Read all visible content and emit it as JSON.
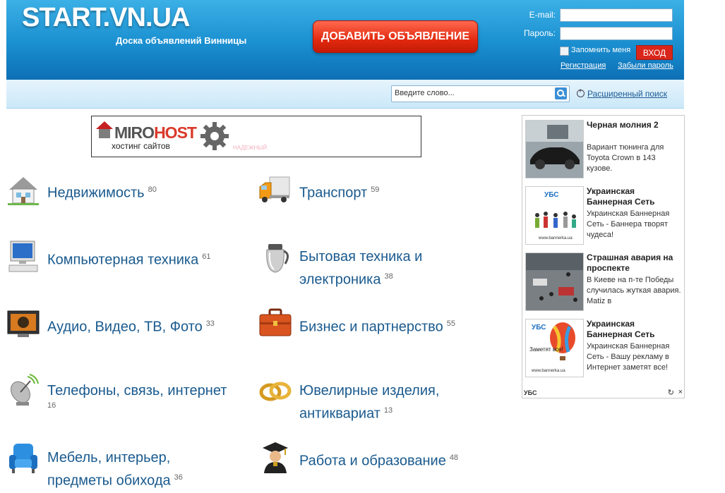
{
  "header": {
    "logo": "START.VN.UA",
    "tagline": "Доска объявлений Винницы",
    "add_button": "ДОБАВИТЬ ОБЪЯВЛЕНИЕ",
    "email_label": "E-mail:",
    "password_label": "Пароль:",
    "remember_label": "Запомнить меня",
    "login_button": "ВХОД",
    "register_link": "Регистрация",
    "forgot_link": "Забыли пароль"
  },
  "search": {
    "placeholder": "Введите слово...",
    "advanced_link": "Расширенный поиск"
  },
  "banner": {
    "brand_a": "MIRO",
    "brand_b": "HOST",
    "subtitle": "хостинг сайтов",
    "tail": "НАДЕЖНЫЙ"
  },
  "categories": [
    {
      "label": "Недвижимость",
      "count": "80",
      "icon": "house-icon"
    },
    {
      "label": "Транспорт",
      "count": "59",
      "icon": "truck-icon"
    },
    {
      "label": "Компьютерная техника",
      "count": "61",
      "icon": "computer-icon"
    },
    {
      "label": "Бытовая техника и",
      "label2": "электроника",
      "count": "38",
      "icon": "kettle-icon"
    },
    {
      "label": "Аудио, Видео, ТВ, Фото",
      "count": "33",
      "icon": "tv-icon"
    },
    {
      "label": "Бизнес и партнерство",
      "count": "55",
      "icon": "briefcase-icon"
    },
    {
      "label": "Телефоны, связь, интернет",
      "count": "16",
      "icon": "satellite-icon"
    },
    {
      "label": "Ювелирные изделия,",
      "label2": "антиквариат",
      "count": "13",
      "icon": "rings-icon"
    },
    {
      "label": "Мебель, интерьер,",
      "label2": "предметы обихода",
      "count": "36",
      "icon": "armchair-icon"
    },
    {
      "label": "Работа и образование",
      "count": "48",
      "icon": "graduate-icon"
    }
  ],
  "sidebar": {
    "items": [
      {
        "title": "Черная молния 2",
        "desc": "Вариант тюнинга для Toyota Crown в 143 кузове."
      },
      {
        "title": "Украинская Баннерная Сеть",
        "desc": "Украинская Баннерная Сеть - Баннера творят чудеса!"
      },
      {
        "title": "Страшная авария на проспекте",
        "desc": "В Киеве на п-те Победы случилась жуткая авария. Matiz в"
      },
      {
        "title": "Украинская Баннерная Сеть",
        "desc": "Украинская Баннерная Сеть - Вашу рекламу в Интернет заметят все!"
      }
    ],
    "thumb_logo": "УБС",
    "thumb_url": "www.bannerka.ua",
    "thumb_slogan": "Заметят все!",
    "footer_logo": "УБС"
  },
  "colors": {
    "header_blue": "#1a8fd0",
    "accent_red": "#e22a10",
    "link_blue": "#1a5a8e"
  }
}
